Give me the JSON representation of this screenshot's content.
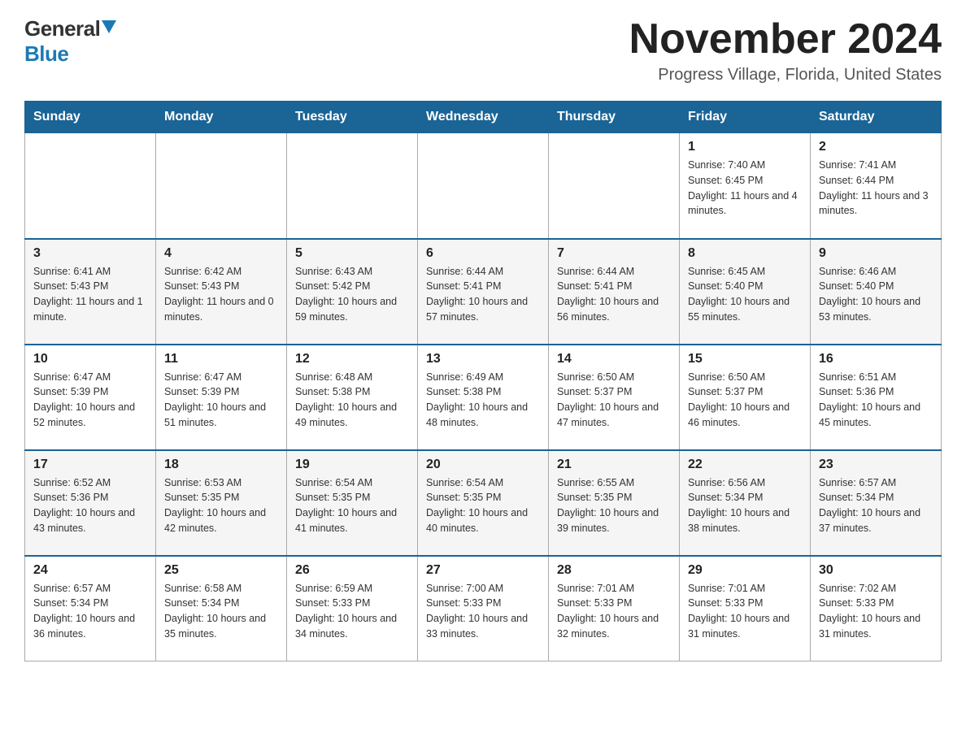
{
  "logo": {
    "general": "General",
    "blue": "Blue"
  },
  "title": "November 2024",
  "location": "Progress Village, Florida, United States",
  "days_of_week": [
    "Sunday",
    "Monday",
    "Tuesday",
    "Wednesday",
    "Thursday",
    "Friday",
    "Saturday"
  ],
  "weeks": [
    [
      {
        "day": "",
        "detail": ""
      },
      {
        "day": "",
        "detail": ""
      },
      {
        "day": "",
        "detail": ""
      },
      {
        "day": "",
        "detail": ""
      },
      {
        "day": "",
        "detail": ""
      },
      {
        "day": "1",
        "detail": "Sunrise: 7:40 AM\nSunset: 6:45 PM\nDaylight: 11 hours and 4 minutes."
      },
      {
        "day": "2",
        "detail": "Sunrise: 7:41 AM\nSunset: 6:44 PM\nDaylight: 11 hours and 3 minutes."
      }
    ],
    [
      {
        "day": "3",
        "detail": "Sunrise: 6:41 AM\nSunset: 5:43 PM\nDaylight: 11 hours and 1 minute."
      },
      {
        "day": "4",
        "detail": "Sunrise: 6:42 AM\nSunset: 5:43 PM\nDaylight: 11 hours and 0 minutes."
      },
      {
        "day": "5",
        "detail": "Sunrise: 6:43 AM\nSunset: 5:42 PM\nDaylight: 10 hours and 59 minutes."
      },
      {
        "day": "6",
        "detail": "Sunrise: 6:44 AM\nSunset: 5:41 PM\nDaylight: 10 hours and 57 minutes."
      },
      {
        "day": "7",
        "detail": "Sunrise: 6:44 AM\nSunset: 5:41 PM\nDaylight: 10 hours and 56 minutes."
      },
      {
        "day": "8",
        "detail": "Sunrise: 6:45 AM\nSunset: 5:40 PM\nDaylight: 10 hours and 55 minutes."
      },
      {
        "day": "9",
        "detail": "Sunrise: 6:46 AM\nSunset: 5:40 PM\nDaylight: 10 hours and 53 minutes."
      }
    ],
    [
      {
        "day": "10",
        "detail": "Sunrise: 6:47 AM\nSunset: 5:39 PM\nDaylight: 10 hours and 52 minutes."
      },
      {
        "day": "11",
        "detail": "Sunrise: 6:47 AM\nSunset: 5:39 PM\nDaylight: 10 hours and 51 minutes."
      },
      {
        "day": "12",
        "detail": "Sunrise: 6:48 AM\nSunset: 5:38 PM\nDaylight: 10 hours and 49 minutes."
      },
      {
        "day": "13",
        "detail": "Sunrise: 6:49 AM\nSunset: 5:38 PM\nDaylight: 10 hours and 48 minutes."
      },
      {
        "day": "14",
        "detail": "Sunrise: 6:50 AM\nSunset: 5:37 PM\nDaylight: 10 hours and 47 minutes."
      },
      {
        "day": "15",
        "detail": "Sunrise: 6:50 AM\nSunset: 5:37 PM\nDaylight: 10 hours and 46 minutes."
      },
      {
        "day": "16",
        "detail": "Sunrise: 6:51 AM\nSunset: 5:36 PM\nDaylight: 10 hours and 45 minutes."
      }
    ],
    [
      {
        "day": "17",
        "detail": "Sunrise: 6:52 AM\nSunset: 5:36 PM\nDaylight: 10 hours and 43 minutes."
      },
      {
        "day": "18",
        "detail": "Sunrise: 6:53 AM\nSunset: 5:35 PM\nDaylight: 10 hours and 42 minutes."
      },
      {
        "day": "19",
        "detail": "Sunrise: 6:54 AM\nSunset: 5:35 PM\nDaylight: 10 hours and 41 minutes."
      },
      {
        "day": "20",
        "detail": "Sunrise: 6:54 AM\nSunset: 5:35 PM\nDaylight: 10 hours and 40 minutes."
      },
      {
        "day": "21",
        "detail": "Sunrise: 6:55 AM\nSunset: 5:35 PM\nDaylight: 10 hours and 39 minutes."
      },
      {
        "day": "22",
        "detail": "Sunrise: 6:56 AM\nSunset: 5:34 PM\nDaylight: 10 hours and 38 minutes."
      },
      {
        "day": "23",
        "detail": "Sunrise: 6:57 AM\nSunset: 5:34 PM\nDaylight: 10 hours and 37 minutes."
      }
    ],
    [
      {
        "day": "24",
        "detail": "Sunrise: 6:57 AM\nSunset: 5:34 PM\nDaylight: 10 hours and 36 minutes."
      },
      {
        "day": "25",
        "detail": "Sunrise: 6:58 AM\nSunset: 5:34 PM\nDaylight: 10 hours and 35 minutes."
      },
      {
        "day": "26",
        "detail": "Sunrise: 6:59 AM\nSunset: 5:33 PM\nDaylight: 10 hours and 34 minutes."
      },
      {
        "day": "27",
        "detail": "Sunrise: 7:00 AM\nSunset: 5:33 PM\nDaylight: 10 hours and 33 minutes."
      },
      {
        "day": "28",
        "detail": "Sunrise: 7:01 AM\nSunset: 5:33 PM\nDaylight: 10 hours and 32 minutes."
      },
      {
        "day": "29",
        "detail": "Sunrise: 7:01 AM\nSunset: 5:33 PM\nDaylight: 10 hours and 31 minutes."
      },
      {
        "day": "30",
        "detail": "Sunrise: 7:02 AM\nSunset: 5:33 PM\nDaylight: 10 hours and 31 minutes."
      }
    ]
  ]
}
